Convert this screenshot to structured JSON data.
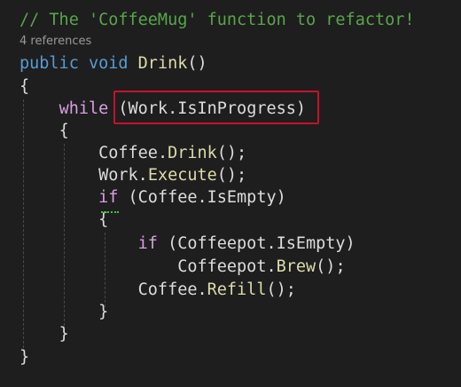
{
  "colors": {
    "background": "#1e1e1e",
    "comment": "#57a64a",
    "keyword": "#569cd6",
    "control": "#d8a0df",
    "method": "#dcdcaa",
    "text": "#dcdcdc",
    "codelens": "#999999",
    "highlight_box": "#c8102e",
    "suggestion_squiggle": "#3cc83c"
  },
  "code": {
    "comment": "// The 'CoffeeMug' function to refactor!",
    "references": "4 references",
    "signature": {
      "modifier": "public",
      "return_type": "void",
      "name": "Drink",
      "params": "()"
    },
    "open_brace_method": "{",
    "while_line": {
      "keyword": "while",
      "condition": "(Work.IsInProgress)"
    },
    "open_brace_while": "{",
    "stmt_coffee_drink": {
      "object": "Coffee",
      "dot": ".",
      "method": "Drink",
      "tail": "();"
    },
    "stmt_work_execute": {
      "object": "Work",
      "dot": ".",
      "method": "Execute",
      "tail": "();"
    },
    "if_outer": {
      "keyword": "if",
      "condition": " (Coffee.IsEmpty)"
    },
    "open_brace_if": "{",
    "if_inner": {
      "keyword": "if",
      "condition": " (Coffeepot.IsEmpty)"
    },
    "stmt_coffeepot_brew": {
      "object": "Coffeepot",
      "dot": ".",
      "method": "Brew",
      "tail": "();"
    },
    "stmt_coffee_refill": {
      "object": "Coffee",
      "dot": ".",
      "method": "Refill",
      "tail": "();"
    },
    "close_brace_if": "}",
    "close_brace_while": "}",
    "close_brace_method": "}"
  }
}
